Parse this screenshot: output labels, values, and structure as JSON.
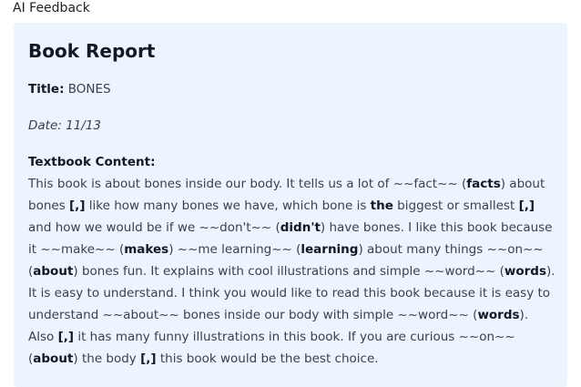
{
  "header": {
    "title": "AI Feedback"
  },
  "report": {
    "heading": "Book Report",
    "title_label": "Title:",
    "title_value": " BONES",
    "date": "Date: 11/13",
    "content_label": "Textbook Content:",
    "content_segments": [
      {
        "t": "This book is about bones inside our body. It tells us a lot of ~~fact~~ (",
        "b": false
      },
      {
        "t": "facts",
        "b": true
      },
      {
        "t": ") about bones ",
        "b": false
      },
      {
        "t": "[,]",
        "b": true
      },
      {
        "t": " like how many bones we have, which bone is ",
        "b": false
      },
      {
        "t": "the",
        "b": true
      },
      {
        "t": " biggest or smallest ",
        "b": false
      },
      {
        "t": "[,]",
        "b": true
      },
      {
        "t": " and how we would be if we ~~don't~~ (",
        "b": false
      },
      {
        "t": "didn't",
        "b": true
      },
      {
        "t": ") have bones. I like this book because it ~~make~~ (",
        "b": false
      },
      {
        "t": "makes",
        "b": true
      },
      {
        "t": ") ~~me learning~~ (",
        "b": false
      },
      {
        "t": "learning",
        "b": true
      },
      {
        "t": ") about many things ~~on~~ (",
        "b": false
      },
      {
        "t": "about",
        "b": true
      },
      {
        "t": ") bones fun. It explains with cool illustrations and simple ~~word~~ (",
        "b": false
      },
      {
        "t": "words",
        "b": true
      },
      {
        "t": "). It is easy to understand. I think you would like to read this book because it is easy to understand ~~about~~ bones inside our body with simple ~~word~~ (",
        "b": false
      },
      {
        "t": "words",
        "b": true
      },
      {
        "t": "). Also ",
        "b": false
      },
      {
        "t": "[,]",
        "b": true
      },
      {
        "t": " it has many funny illustrations in this book. If you are curious ~~on~~ (",
        "b": false
      },
      {
        "t": "about",
        "b": true
      },
      {
        "t": ") the body ",
        "b": false
      },
      {
        "t": "[,]",
        "b": true
      },
      {
        "t": " this book would be the best choice.",
        "b": false
      }
    ]
  },
  "colors": {
    "card_background": "#eef4fd",
    "text": "#374151",
    "heading": "#111827"
  }
}
